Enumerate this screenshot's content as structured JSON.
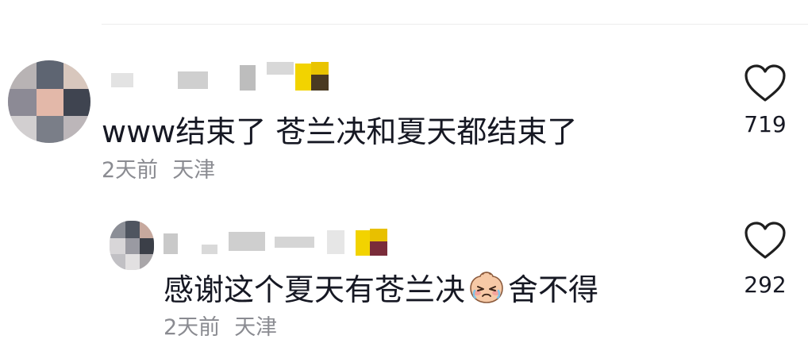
{
  "comments": [
    {
      "text": "www结束了 苍兰决和夏天都结束了",
      "time": "2天前",
      "location": "天津",
      "likes": "719"
    },
    {
      "text_before_emoji": "感谢这个夏天有苍兰决",
      "emoji": "crying-face-emoji",
      "text_after_emoji": "舍不得",
      "time": "2天前",
      "location": "天津",
      "likes": "292"
    }
  ],
  "icons": {
    "like": "heart-outline-icon"
  },
  "colors": {
    "text": "#161823",
    "meta": "#8a8b91",
    "icon": "#1f1f1f",
    "divider": "#ededed"
  }
}
